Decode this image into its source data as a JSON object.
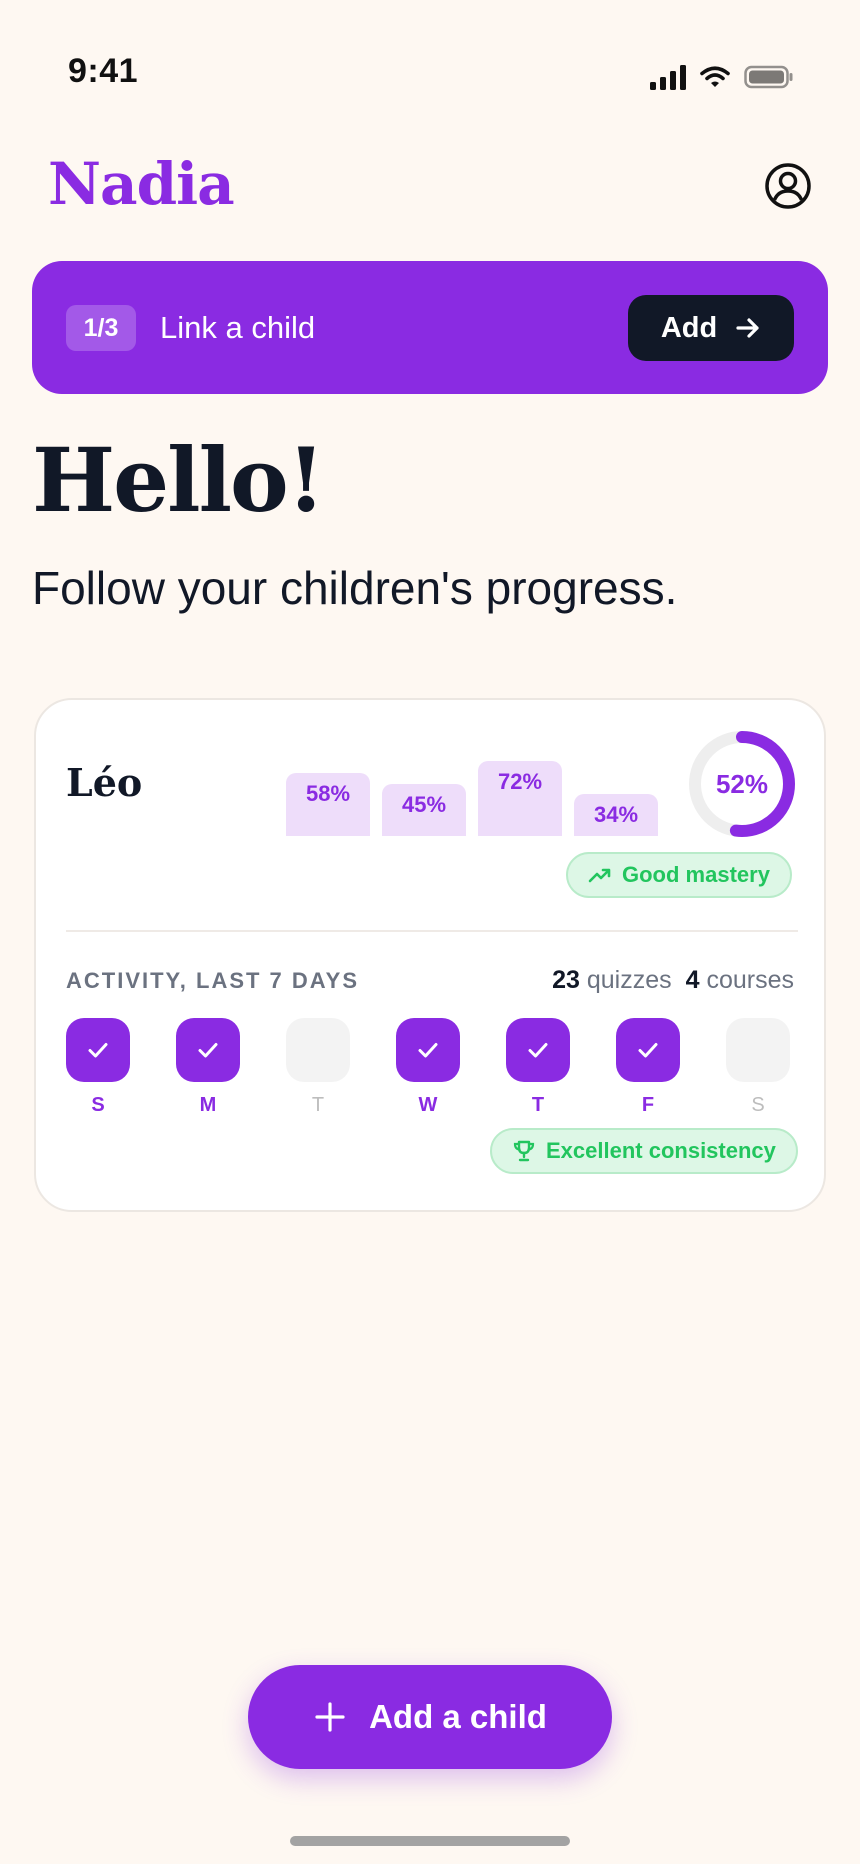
{
  "status_bar": {
    "time": "9:41"
  },
  "header": {
    "brand": "Nadia"
  },
  "banner": {
    "step": "1/3",
    "text": "Link a child",
    "button_label": "Add"
  },
  "greeting": {
    "title": "Hello!",
    "subtitle": "Follow your children's progress."
  },
  "child": {
    "name": "Léo",
    "subjects": [
      {
        "percent": 58,
        "label": "58%"
      },
      {
        "percent": 45,
        "label": "45%"
      },
      {
        "percent": 72,
        "label": "72%"
      },
      {
        "percent": 34,
        "label": "34%"
      }
    ],
    "overall": {
      "percent": 52,
      "label": "52%"
    },
    "mastery_badge": "Good mastery",
    "activity": {
      "label": "ACTIVITY, LAST 7 DAYS",
      "quizzes_count": "23",
      "quizzes_label": "quizzes",
      "courses_count": "4",
      "courses_label": "courses",
      "days": [
        {
          "letter": "S",
          "active": true
        },
        {
          "letter": "M",
          "active": true
        },
        {
          "letter": "T",
          "active": false
        },
        {
          "letter": "W",
          "active": true
        },
        {
          "letter": "T",
          "active": true
        },
        {
          "letter": "F",
          "active": true
        },
        {
          "letter": "S",
          "active": false
        }
      ]
    },
    "consistency_badge": "Excellent consistency"
  },
  "fab": {
    "label": "Add a child"
  },
  "colors": {
    "accent": "#8A2BE2",
    "background": "#FEF8F2",
    "success": "#22C55E",
    "dark": "#111827"
  }
}
